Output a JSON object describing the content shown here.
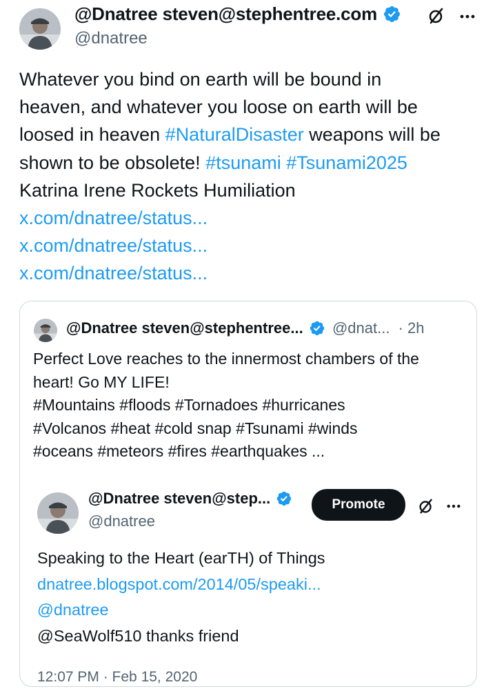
{
  "post": {
    "display_name": "@Dnatree steven@stephentree.com",
    "handle": "@dnatree",
    "text_lines": [
      [
        {
          "t": "Whatever you bind on earth will be bound in",
          "link": false
        }
      ],
      [
        {
          "t": "heaven, and whatever you loose on earth will be",
          "link": false
        }
      ],
      [
        {
          "t": "loosed in heaven ",
          "link": false
        },
        {
          "t": "#NaturalDisaster",
          "link": true
        },
        {
          "t": " weapons will be",
          "link": false
        }
      ],
      [
        {
          "t": "shown to be obsolete! ",
          "link": false
        },
        {
          "t": "#tsunami",
          "link": true
        },
        {
          "t": " ",
          "link": false
        },
        {
          "t": "#Tsunami2025",
          "link": true
        }
      ],
      [
        {
          "t": "Katrina Irene Rockets Humiliation",
          "link": false
        }
      ],
      [
        {
          "t": "x.com/dnatree/status...",
          "link": true
        }
      ],
      [
        {
          "t": "x.com/dnatree/status...",
          "link": true
        }
      ],
      [
        {
          "t": "x.com/dnatree/status...",
          "link": true
        }
      ]
    ]
  },
  "quote": {
    "display_name": "@Dnatree steven@stephentree...",
    "handle": "@dnat...",
    "time": "· 2h",
    "text_lines": [
      "Perfect Love reaches to the innermost chambers of the",
      "heart! Go MY LIFE!",
      "#Mountains #floods #Tornadoes #hurricanes",
      "#Volcanos #heat #cold snap #Tsunami #winds",
      "#oceans #meteors #fires #earthquakes  ..."
    ]
  },
  "inner": {
    "display_name": "@Dnatree steven@step...",
    "handle": "@dnatree",
    "promote_label": "Promote",
    "title": "Speaking to the Heart (earTH) of Things",
    "url": "dnatree.blogspot.com/2014/05/speaki...",
    "mention": "@dnatree",
    "reply": "@SeaWolf510 thanks friend",
    "timestamp": "12:07 PM · Feb 15, 2020"
  },
  "colors": {
    "link": "#1d9bf0",
    "verified": "#1d9bf0",
    "border": "#cfd9de",
    "muted": "#536471"
  },
  "icons": [
    "grok-icon",
    "more-icon",
    "verified-badge-icon"
  ]
}
